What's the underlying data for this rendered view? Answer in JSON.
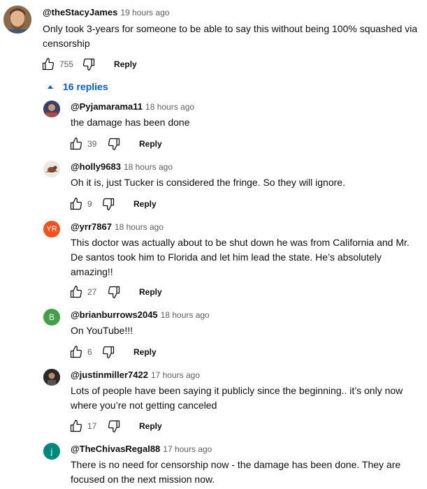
{
  "top_comment": {
    "handle": "@theStacyJames",
    "time": "19 hours ago",
    "text_line1": "Only took 3-years for someone to be able to say this without being 100% squashed via",
    "text_line2": "censorship",
    "likes": "755",
    "reply_label": "Reply"
  },
  "replies_toggle": {
    "label": "16 replies"
  },
  "replies": [
    {
      "handle": "@Pyjamarama11",
      "time": "18 hours ago",
      "lines": [
        "the damage has been done"
      ],
      "likes": "39",
      "reply_label": "Reply",
      "avatar": {
        "initials": "",
        "bg": "#4a4a6a"
      }
    },
    {
      "handle": "@holly9683",
      "time": "18 hours ago",
      "lines": [
        "Oh it is, just Tucker is considered the fringe. So they will ignore."
      ],
      "likes": "9",
      "reply_label": "Reply",
      "avatar": {
        "initials": "",
        "bg": "#e9e4dd"
      }
    },
    {
      "handle": "@yrr7867",
      "time": "18 hours ago",
      "lines": [
        "This doctor was actually about to be shut down he was from California and Mr.",
        "De santos took him to Florida and let him lead the state. He’s absolutely",
        "amazing!!"
      ],
      "likes": "27",
      "reply_label": "Reply",
      "avatar": {
        "initials": "YR",
        "bg": "#f4511e"
      }
    },
    {
      "handle": "@brianburrows2045",
      "time": "18 hours ago",
      "lines": [
        "On YouTube!!!"
      ],
      "likes": "6",
      "reply_label": "Reply",
      "avatar": {
        "initials": "B",
        "bg": "#43a047"
      }
    },
    {
      "handle": "@justinmiller7422",
      "time": "17 hours ago",
      "lines": [
        "Lots of people have been saying it publicly since the beginning.. it’s only now",
        "where you’re not getting canceled"
      ],
      "likes": "17",
      "reply_label": "Reply",
      "avatar": {
        "initials": "",
        "bg": "#2b2b2b"
      }
    },
    {
      "handle": "@TheChivasRegal88",
      "time": "17 hours ago",
      "lines": [
        "There is no need for censorship now - the damage has been done. They are",
        "focused on the next mission now."
      ],
      "likes": "",
      "reply_label": "",
      "avatar": {
        "initials": "j",
        "bg": "#00897b"
      }
    }
  ],
  "colors": {
    "link_blue": "#065fd4",
    "meta_gray": "#606060",
    "text": "#0f0f0f"
  }
}
